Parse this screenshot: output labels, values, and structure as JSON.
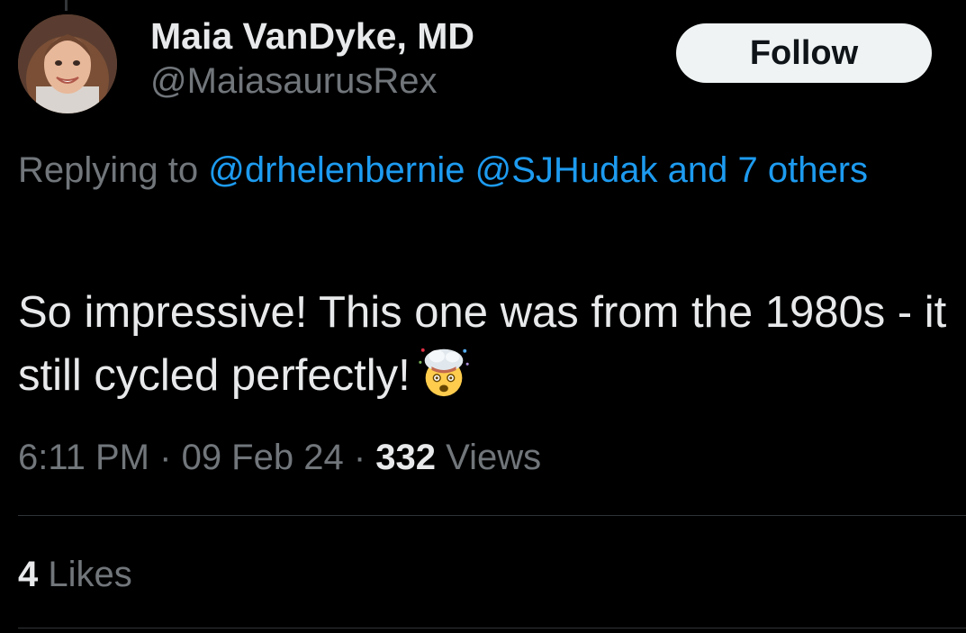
{
  "author": {
    "display_name": "Maia VanDyke, MD",
    "handle": "@MaiasaurusRex"
  },
  "follow_button": {
    "label": "Follow"
  },
  "reply": {
    "prefix": "Replying to",
    "mentions": [
      "@drhelenbernie",
      "@SJHudak"
    ],
    "others_label": "and 7 others"
  },
  "tweet": {
    "text": "So impressive! This one was from the 1980s - it still cycled perfectly!",
    "emoji": "exploding-head-icon"
  },
  "meta": {
    "time": "6:11 PM",
    "separator": "·",
    "date": "09 Feb 24",
    "views_count": "332",
    "views_label": "Views"
  },
  "engagement": {
    "likes_count": "4",
    "likes_label": "Likes"
  },
  "colors": {
    "background": "#000000",
    "primary_text": "#e7e9ea",
    "secondary_text": "#71767b",
    "link": "#1d9bf0",
    "follow_bg": "#eff3f4",
    "divider": "#2f3336"
  }
}
